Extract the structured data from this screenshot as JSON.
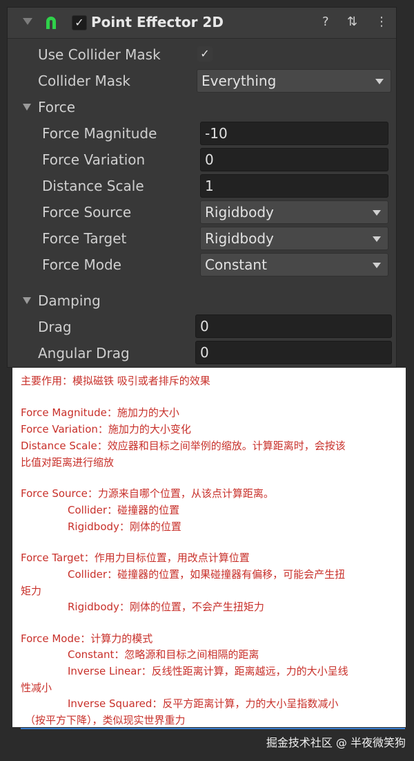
{
  "component": {
    "title": "Point Effector 2D",
    "enabled_mark": "✓",
    "icons": {
      "magnet": "magnet-icon",
      "help": "?",
      "presets": "⇅",
      "more": "⋮"
    }
  },
  "fields": {
    "use_collider_mask": {
      "label": "Use Collider Mask",
      "mark": "✓"
    },
    "collider_mask": {
      "label": "Collider Mask",
      "value": "Everything"
    },
    "force_section": "Force",
    "force_magnitude": {
      "label": "Force Magnitude",
      "value": "-10"
    },
    "force_variation": {
      "label": "Force Variation",
      "value": "0"
    },
    "distance_scale": {
      "label": "Distance Scale",
      "value": "1"
    },
    "force_source": {
      "label": "Force Source",
      "value": "Rigidbody"
    },
    "force_target": {
      "label": "Force Target",
      "value": "Rigidbody"
    },
    "force_mode": {
      "label": "Force Mode",
      "value": "Constant"
    },
    "damping_section": "Damping",
    "drag": {
      "label": "Drag",
      "value": "0"
    },
    "angular_drag": {
      "label": "Angular Drag",
      "value": "0"
    }
  },
  "notes": [
    "主要作用：模拟磁铁 吸引或者排斥的效果",
    "Force Magnitude：施加力的大小",
    "Force Variation：施加力的大小变化",
    "Distance Scale：效应器和目标之间举例的缩放。计算距离时，会按该",
    "比值对距离进行缩放",
    "Force Source：力源来自哪个位置，从该点计算距离。",
    "Collider：碰撞器的位置",
    "Rigidbody：刚体的位置",
    "Force Target：作用力目标位置，用改点计算位置",
    "Collider：碰撞器的位置，如果碰撞器有偏移，可能会产生扭",
    "矩力",
    "Rigidbody：刚体的位置，不会产生扭矩力",
    "Force Mode：计算力的模式",
    "Constant：忽略源和目标之间相隔的距离",
    "Inverse Linear：反线性距离计算，距离越远，力的大小呈线",
    "性减小",
    "Inverse Squared：反平方距离计算，力的大小呈指数减小",
    "（按平方下降），类似现实世界重力"
  ],
  "footer": "掘金技术社区 @ 半夜微笑狗"
}
